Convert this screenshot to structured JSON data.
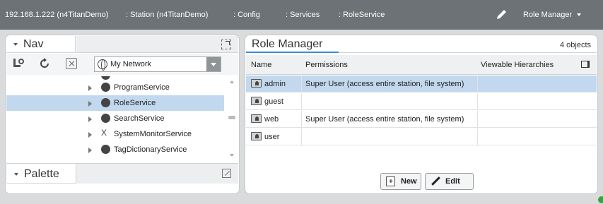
{
  "breadcrumb": {
    "host": "192.168.1.222 (n4TitanDemo)",
    "items": [
      ": Station (n4TitanDemo)",
      ": Config",
      ": Services",
      ": RoleService"
    ],
    "view_menu_label": "Role Manager",
    "view_icon": "pencil-icon"
  },
  "nav": {
    "title": "Nav",
    "network_select_value": "My Network",
    "tree": [
      {
        "label": "ProgramService",
        "icon": "program-icon"
      },
      {
        "label": "RoleService",
        "icon": "role-icon",
        "selected": true
      },
      {
        "label": "SearchService",
        "icon": "search-service-icon"
      },
      {
        "label": "SystemMonitorService",
        "icon": "monitor-icon"
      },
      {
        "label": "TagDictionaryService",
        "icon": "tag-icon"
      }
    ]
  },
  "palette": {
    "title": "Palette"
  },
  "role_manager": {
    "title": "Role Manager",
    "count": "4 objects",
    "columns": [
      "Name",
      "Permissions",
      "Viewable Hierarchies"
    ],
    "rows": [
      {
        "name": "admin",
        "permissions": "Super User (access entire station, file system)",
        "hierarchies": "",
        "selected": true
      },
      {
        "name": "guest",
        "permissions": "",
        "hierarchies": ""
      },
      {
        "name": "web",
        "permissions": "Super User (access entire station, file system)",
        "hierarchies": ""
      },
      {
        "name": "user",
        "permissions": "",
        "hierarchies": ""
      }
    ],
    "buttons": {
      "new_label": "New",
      "edit_label": "Edit"
    }
  },
  "colors": {
    "topbar": "#6c7275",
    "selection": "#c2d8ee",
    "accent": "#3e8fd1"
  }
}
